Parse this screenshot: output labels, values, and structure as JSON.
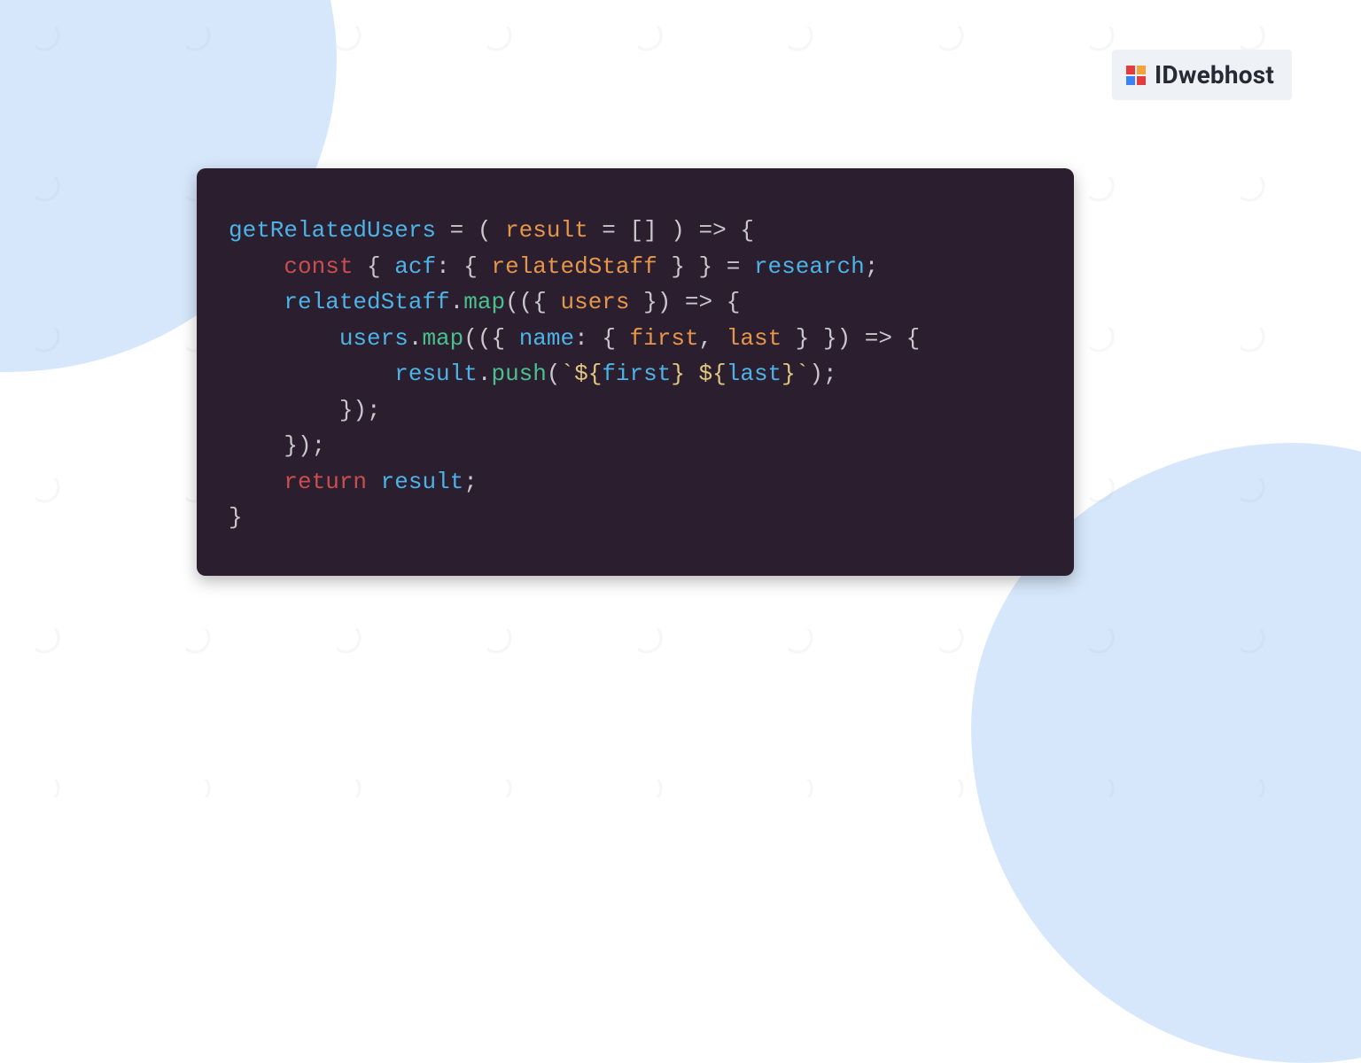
{
  "logo": {
    "text": "IDwebhost"
  },
  "code": {
    "t": {
      "getRelatedUsers": "getRelatedUsers",
      "result": "result",
      "const": "const",
      "acf": "acf",
      "relatedStaff": "relatedStaff",
      "research": "research",
      "map": "map",
      "users": "users",
      "name": "name",
      "first": "first",
      "last": "last",
      "push": "push",
      "return": "return",
      "tpl_open1": "`${",
      "tpl_mid": "} ${",
      "tpl_close": "}`"
    }
  }
}
